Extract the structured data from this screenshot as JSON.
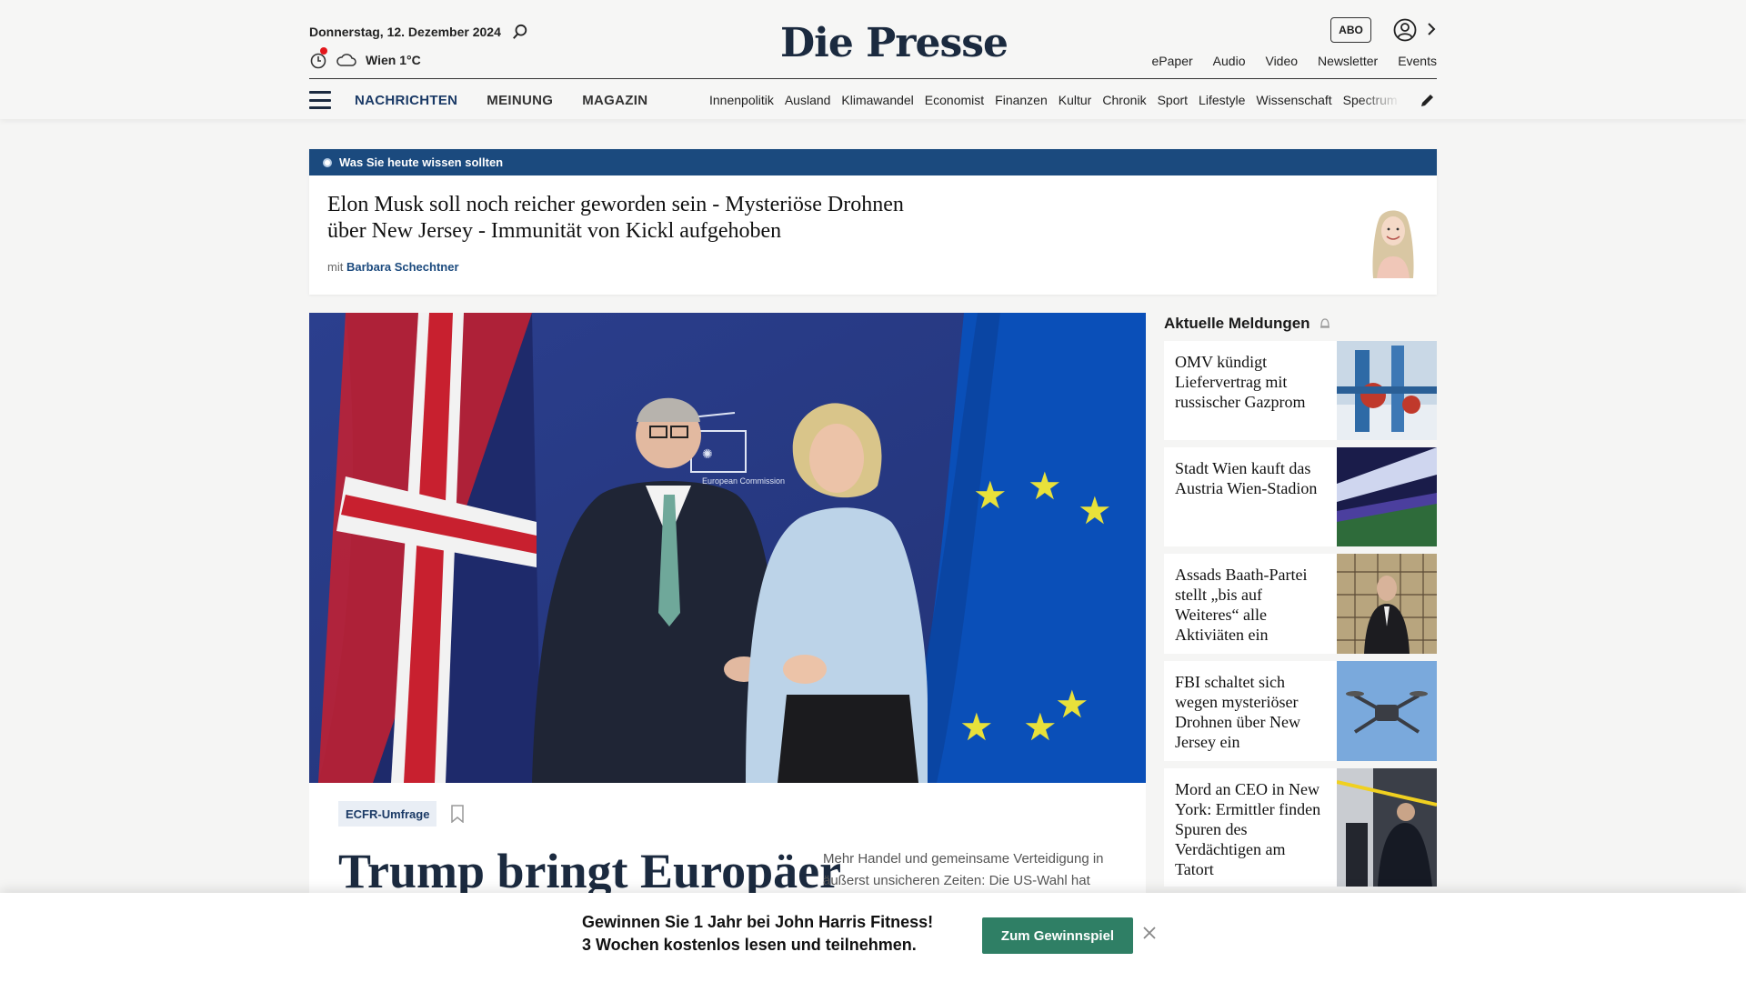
{
  "header": {
    "date": "Donnerstag, 12. Dezember 2024",
    "weather": "Wien 1°C",
    "logo": "Die Presse",
    "abo_label": "ABO",
    "top_links": [
      "ePaper",
      "Audio",
      "Video",
      "Newsletter",
      "Events"
    ],
    "main_nav": [
      "NACHRICHTEN",
      "MEINUNG",
      "MAGAZIN"
    ],
    "sub_nav": [
      "Innenpolitik",
      "Ausland",
      "Klimawandel",
      "Economist",
      "Finanzen",
      "Kultur",
      "Chronik",
      "Sport",
      "Lifestyle",
      "Wissenschaft",
      "Spectrum"
    ],
    "icons": [
      "search-icon",
      "clock-icon",
      "cloud-icon",
      "user-icon",
      "chevron-right-icon",
      "menu-icon",
      "pencil-icon"
    ],
    "colors": {
      "brand": "#1b2a3f",
      "accent_blue": "#1b4a7e",
      "alert_red": "#e3161b"
    }
  },
  "briefing": {
    "bar_label": "Was Sie heute wissen sollten",
    "title": "Elon Musk soll noch reicher geworden sein - Mysteriöse Drohnen über New Jersey - Immunität von Kickl aufgehoben",
    "author_prefix": "mit",
    "author_name": "Barbara Schechtner"
  },
  "hero": {
    "image_caption_text": "European Commission",
    "tag": "ECFR-Umfrage",
    "title": "Trump bringt Europäer",
    "teaser": "Mehr Handel und gemeinsame Verteidigung in äußerst unsicheren Zeiten: Die US-Wahl hat"
  },
  "sidebar": {
    "heading": "Aktuelle Meldungen",
    "items": [
      {
        "title": "OMV kündigt Liefervertrag mit russischer Gazprom"
      },
      {
        "title": "Stadt Wien kauft das Austria Wien-Stadion"
      },
      {
        "title": "Assads Baath-Partei stellt „bis auf Weiteres“ alle Aktiviäten ein"
      },
      {
        "title": "FBI schaltet sich wegen mysteriöser Drohnen über New Jersey ein"
      },
      {
        "title": "Mord an CEO in New York: Ermittler finden Spuren des Verdächtigen am Tatort"
      }
    ]
  },
  "promo": {
    "line1": "Gewinnen Sie 1 Jahr bei John Harris Fitness!",
    "line2": "3 Wochen kostenlos lesen und teilnehmen.",
    "button_label": "Zum Gewinnspiel",
    "button_color": "#2f7f65"
  }
}
